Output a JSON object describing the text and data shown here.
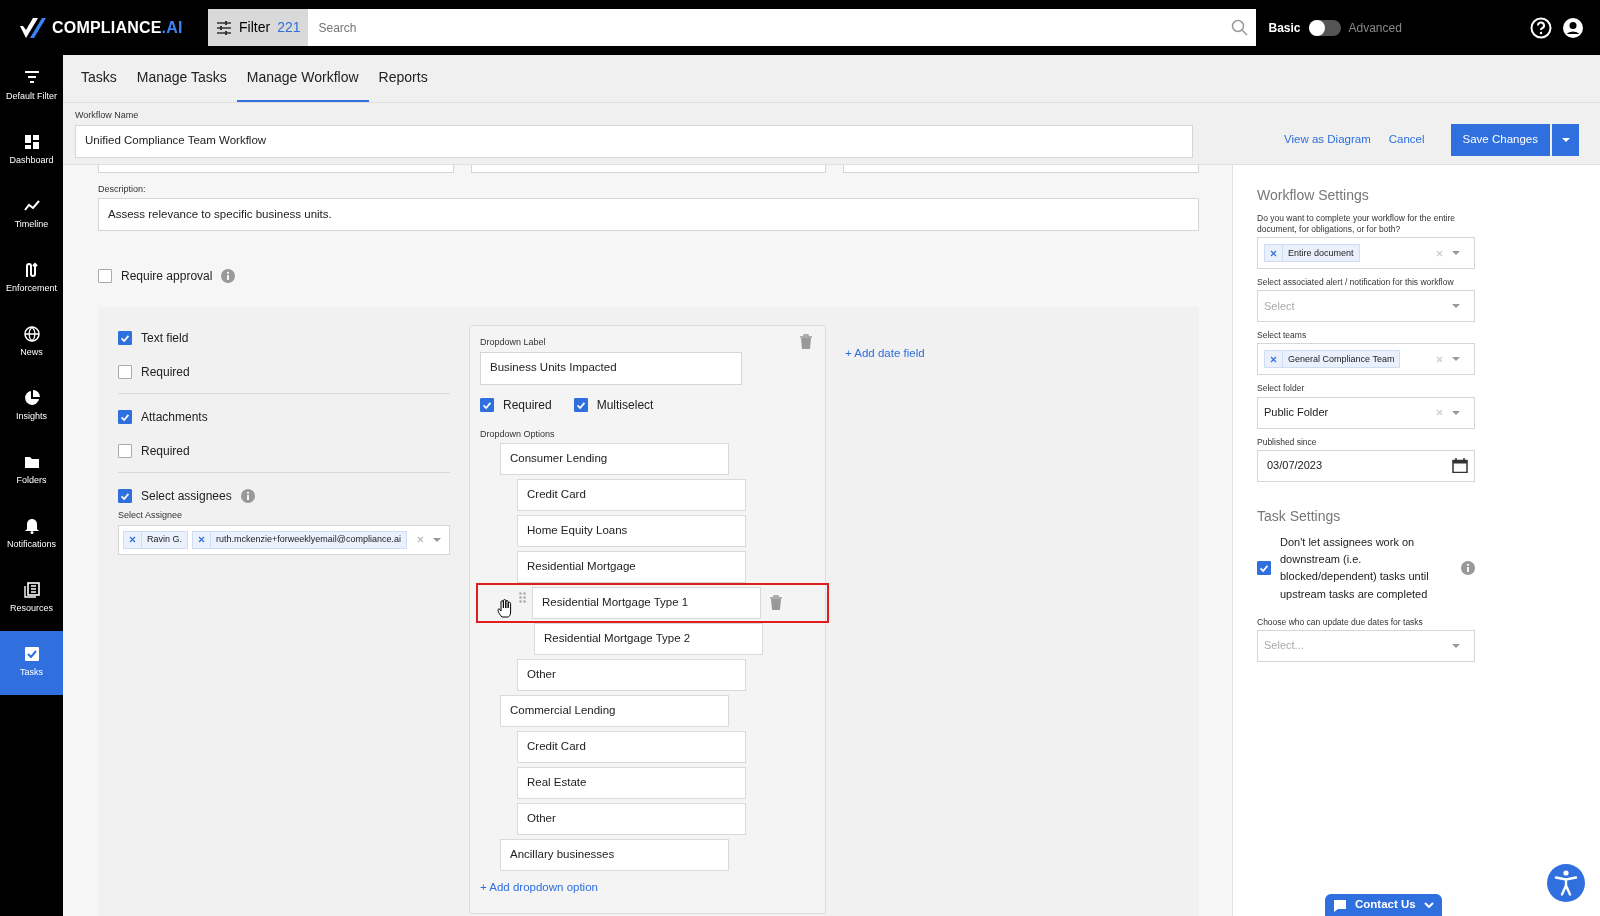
{
  "app": {
    "logo_text": "COMPLIANCE",
    "logo_suffix": ".AI"
  },
  "filter": {
    "label": "Filter",
    "count": "221"
  },
  "search": {
    "placeholder": "Search"
  },
  "mode_toggle": {
    "left_label": "Basic",
    "right_label": "Advanced",
    "on": false
  },
  "sidebar": {
    "items": [
      {
        "label": "Default Filter",
        "selected": false
      },
      {
        "label": "Dashboard",
        "selected": false
      },
      {
        "label": "Timeline",
        "selected": false
      },
      {
        "label": "Enforcement",
        "selected": false
      },
      {
        "label": "News",
        "selected": false
      },
      {
        "label": "Insights",
        "selected": false
      },
      {
        "label": "Folders",
        "selected": false
      },
      {
        "label": "Notifications",
        "selected": false
      },
      {
        "label": "Resources",
        "selected": false
      },
      {
        "label": "Tasks",
        "selected": true
      }
    ]
  },
  "tabs": [
    {
      "label": "Tasks",
      "selected": false
    },
    {
      "label": "Manage Tasks",
      "selected": false
    },
    {
      "label": "Manage Workflow",
      "selected": true
    },
    {
      "label": "Reports",
      "selected": false
    }
  ],
  "workflow_name": {
    "label": "Workflow Name",
    "value": "Unified Compliance Team Workflow"
  },
  "header_actions": {
    "links": [
      "View as Diagram",
      "Cancel"
    ],
    "primary": "Save Changes"
  },
  "description": {
    "label": "Description:",
    "value": "Assess relevance to specific business units."
  },
  "require_approval": {
    "label": "Require approval",
    "checked": false,
    "info": true
  },
  "field_groups": [
    [
      {
        "label": "Text field",
        "checked": true,
        "info": false
      },
      {
        "label": "Required",
        "checked": false,
        "info": false
      }
    ],
    [
      {
        "label": "Attachments",
        "checked": true,
        "info": false
      },
      {
        "label": "Required",
        "checked": false,
        "info": false
      }
    ],
    [
      {
        "label": "Select assignees",
        "checked": true,
        "info": true
      }
    ]
  ],
  "assignee_select": {
    "label": "Select Assignee",
    "tags": [
      "Ravin G.",
      "ruth.mckenzie+forweeklyemail@compliance.ai"
    ]
  },
  "dropdown_field": {
    "label_caption": "Dropdown Label",
    "label_value": "Business Units Impacted",
    "flags": [
      {
        "label": "Required",
        "checked": true
      },
      {
        "label": "Multiselect",
        "checked": true
      }
    ],
    "options_caption": "Dropdown Options",
    "options": [
      {
        "label": "Consumer Lending",
        "selected": false,
        "children": [
          {
            "label": "Credit Card",
            "selected": false
          },
          {
            "label": "Home Equity Loans",
            "selected": false
          },
          {
            "label": "Residential Mortgage",
            "selected": false,
            "children": [
              {
                "label": "Residential Mortgage Type 1",
                "selected": true
              },
              {
                "label": "Residential Mortgage Type 2",
                "selected": false
              }
            ]
          },
          {
            "label": "Other",
            "selected": false
          }
        ]
      },
      {
        "label": "Commercial Lending",
        "selected": false,
        "children": [
          {
            "label": "Credit Card",
            "selected": false
          },
          {
            "label": "Real Estate",
            "selected": false
          },
          {
            "label": "Other",
            "selected": false
          }
        ]
      },
      {
        "label": "Ancillary businesses",
        "selected": false
      }
    ],
    "add_option": "+ Add dropdown option"
  },
  "add_date_field": "+ Add date field",
  "workflow_settings": {
    "title": "Workflow Settings",
    "fields": [
      {
        "kind": "tags",
        "label": "Do you want to complete your workflow for the entire document, for obligations, or for both?",
        "tags": [
          "Entire document"
        ]
      },
      {
        "kind": "select",
        "label": "Select associated alert / notification for this workflow",
        "placeholder": "Select"
      },
      {
        "kind": "tags",
        "label": "Select teams",
        "tags": [
          "General Compliance Team"
        ]
      },
      {
        "kind": "select",
        "label": "Select folder",
        "value": "Public Folder"
      },
      {
        "kind": "date",
        "label": "Published since",
        "value": "03/07/2023"
      }
    ]
  },
  "task_settings": {
    "title": "Task Settings",
    "rule": {
      "label": "Don't let assignees work on downstream (i.e. blocked/dependent) tasks until upstream tasks are completed",
      "checked": true
    },
    "due_dates": {
      "label": "Choose who can update due dates for tasks",
      "placeholder": "Select..."
    }
  },
  "contact_button": {
    "label": "Contact Us"
  }
}
